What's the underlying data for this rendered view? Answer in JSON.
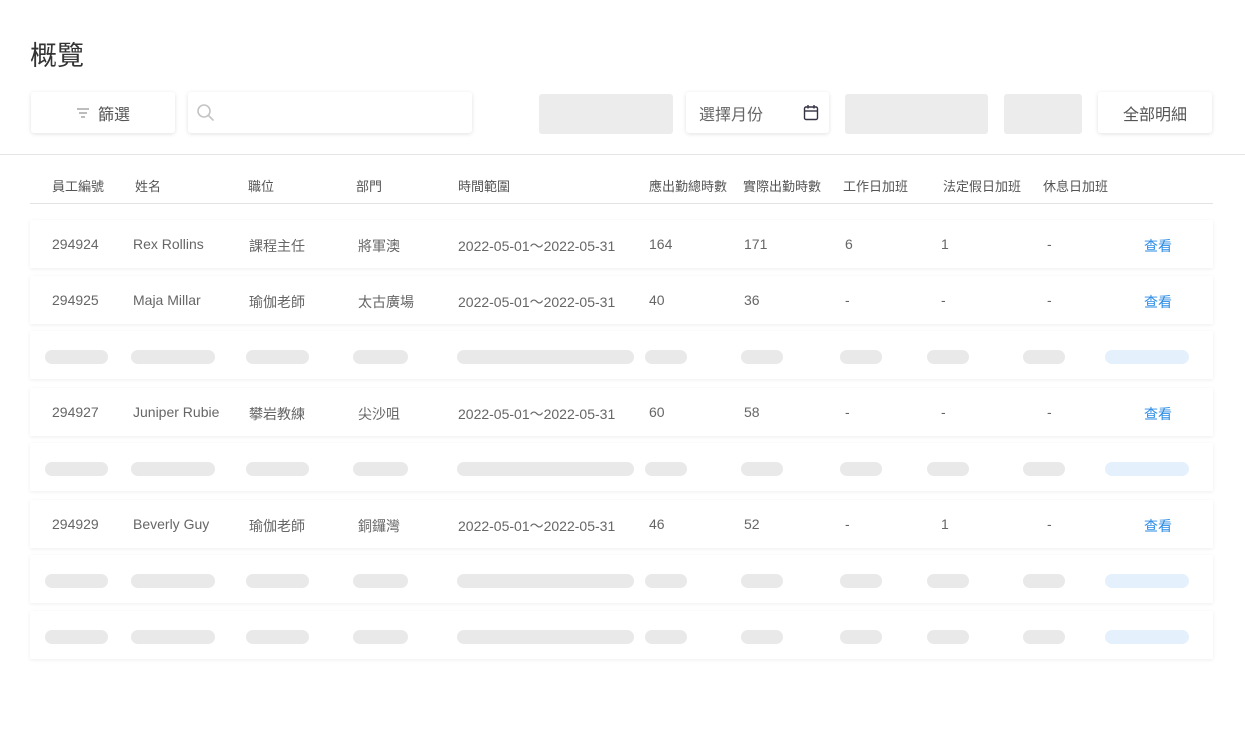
{
  "page": {
    "title": "概覽"
  },
  "toolbar": {
    "filter_label": "篩選",
    "search_value": "",
    "month_placeholder": "選擇月份",
    "all_details_label": "全部明細"
  },
  "table": {
    "headers": [
      "員工編號",
      "姓名",
      "職位",
      "部門",
      "時間範圍",
      "應出勤總時數",
      "實際出勤時數",
      "工作日加班",
      "法定假日加班",
      "休息日加班"
    ],
    "rows": [
      {
        "loaded": true,
        "id": "294924",
        "name": "Rex Rollins",
        "position": "課程主任",
        "department": "將軍澳",
        "range": "2022-05-01～2022-05-31",
        "expected": "164",
        "actual": "171",
        "weekday_ot": "6",
        "holiday_ot": "1",
        "restday_ot": "-",
        "action": "查看"
      },
      {
        "loaded": true,
        "id": "294925",
        "name": "Maja Millar",
        "position": "瑜伽老師",
        "department": "太古廣場",
        "range": "2022-05-01～2022-05-31",
        "expected": "40",
        "actual": "36",
        "weekday_ot": "-",
        "holiday_ot": "-",
        "restday_ot": "-",
        "action": "查看"
      },
      {
        "loaded": false
      },
      {
        "loaded": true,
        "id": "294927",
        "name": "Juniper Rubie",
        "position": "攀岩教練",
        "department": "尖沙咀",
        "range": "2022-05-01～2022-05-31",
        "expected": "60",
        "actual": "58",
        "weekday_ot": "-",
        "holiday_ot": "-",
        "restday_ot": "-",
        "action": "查看"
      },
      {
        "loaded": false
      },
      {
        "loaded": true,
        "id": "294929",
        "name": "Beverly Guy",
        "position": "瑜伽老師",
        "department": "銅鑼灣",
        "range": "2022-05-01～2022-05-31",
        "expected": "46",
        "actual": "52",
        "weekday_ot": "-",
        "holiday_ot": "1",
        "restday_ot": "-",
        "action": "查看"
      },
      {
        "loaded": false
      },
      {
        "loaded": false
      }
    ]
  },
  "icons": {
    "filter": "filter-icon",
    "search": "search-icon",
    "calendar": "calendar-icon"
  },
  "colors": {
    "link": "#2b8ce6",
    "skeleton": "#e9e9e9",
    "skeleton_accent": "#e4f1fc"
  }
}
